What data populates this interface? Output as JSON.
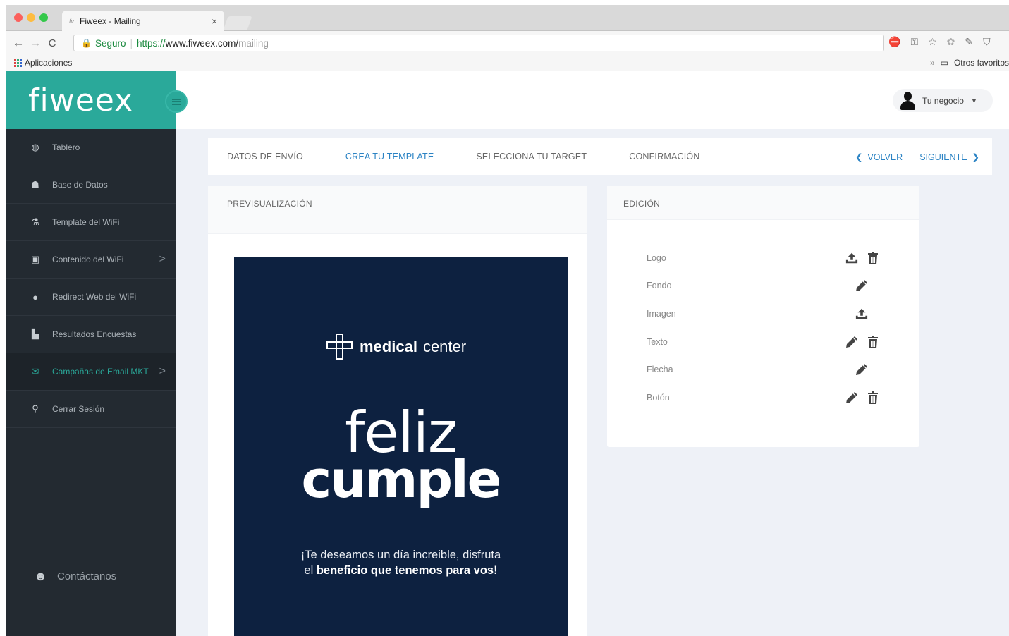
{
  "browser": {
    "tab_title": "Fiweex - Mailing",
    "tab_favicon": "fv",
    "tab_close": "×",
    "secure_label": "Seguro",
    "url_scheme": "https://",
    "url_domain": "www.fiweex.com/",
    "url_path": "mailing",
    "bookmarks_apps": "Aplicaciones",
    "bookmarks_more": "»",
    "bookmarks_other": "Otros favoritos",
    "traffic_colors": [
      "#fc605c",
      "#fdbc40",
      "#34c84a"
    ]
  },
  "sidebar": {
    "logo": "fiweex",
    "items": [
      {
        "label": "Tablero",
        "icon": "dashboard-icon",
        "active": false,
        "chevron": ""
      },
      {
        "label": "Base de Datos",
        "icon": "users-icon",
        "active": false,
        "chevron": ""
      },
      {
        "label": "Template del WiFi",
        "icon": "flask-icon",
        "active": false,
        "chevron": ""
      },
      {
        "label": "Contenido del WiFi",
        "icon": "archive-icon",
        "active": false,
        "chevron": ">"
      },
      {
        "label": "Redirect Web del WiFi",
        "icon": "globe-icon",
        "active": false,
        "chevron": ""
      },
      {
        "label": "Resultados Encuestas",
        "icon": "chart-icon",
        "active": false,
        "chevron": ""
      },
      {
        "label": "Campañas de Email MKT",
        "icon": "envelope-icon",
        "active": true,
        "chevron": ">"
      },
      {
        "label": "Cerrar Sesión",
        "icon": "key-icon",
        "active": false,
        "chevron": ""
      }
    ],
    "contact": "Contáctanos"
  },
  "header": {
    "user_label": "Tu negocio"
  },
  "steps": {
    "items": [
      "DATOS DE ENVÍO",
      "CREA TU TEMPLATE",
      "SELECCIONA TU TARGET",
      "CONFIRMACIÓN"
    ],
    "current_index": 1,
    "back": "VOLVER",
    "next": "SIGUIENTE"
  },
  "preview": {
    "title": "PREVISUALIZACIÓN",
    "brand_bold": "medical",
    "brand_light": "center",
    "headline_1": "feliz",
    "headline_2": "cumple",
    "message_1": "¡Te deseamos un día increible, disfruta",
    "message_2_prefix": "el ",
    "message_2_bold": "beneficio que tenemos para vos!",
    "background": "#0d2140"
  },
  "edit": {
    "title": "EDICIÓN",
    "rows": [
      {
        "label": "Logo",
        "tools": [
          "upload-icon",
          "trash-icon"
        ]
      },
      {
        "label": "Fondo",
        "tools": [
          "pencil-icon"
        ]
      },
      {
        "label": "Imagen",
        "tools": [
          "upload-icon"
        ]
      },
      {
        "label": "Texto",
        "tools": [
          "pencil-icon",
          "trash-icon"
        ]
      },
      {
        "label": "Flecha",
        "tools": [
          "pencil-icon"
        ]
      },
      {
        "label": "Botón",
        "tools": [
          "pencil-icon",
          "trash-icon"
        ]
      }
    ]
  },
  "colors": {
    "brand_teal": "#2aa99a",
    "sidebar_bg": "#232a31",
    "accent_blue": "#2b83c4",
    "content_bg": "#eef1f7"
  }
}
